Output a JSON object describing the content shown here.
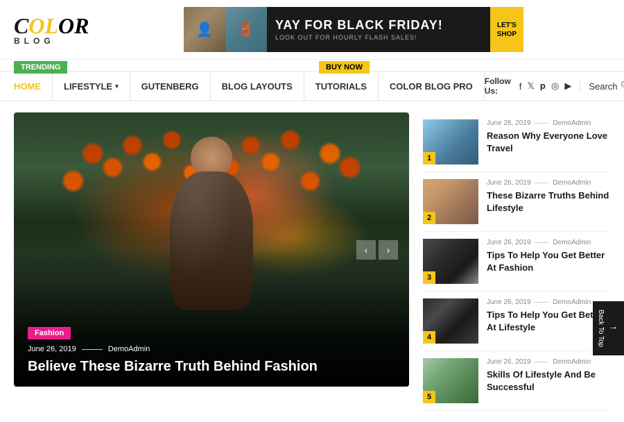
{
  "header": {
    "logo_color": "COLOR",
    "logo_blog": "BLOG",
    "ad": {
      "title": "YAY FOR BLACK FRIDAY!",
      "subtitle": "LOOK OUT FOR HOURLY FLASH SALES!",
      "button": "LET'S\nSHOP"
    }
  },
  "trending_bar": {
    "trending_label": "TRENDING",
    "buy_now_label": "BUY NOW"
  },
  "nav": {
    "items": [
      {
        "label": "HOME",
        "active": true,
        "has_dropdown": false
      },
      {
        "label": "LIFESTYLE",
        "active": false,
        "has_dropdown": true
      },
      {
        "label": "GUTENBERG",
        "active": false,
        "has_dropdown": false
      },
      {
        "label": "BLOG LAYOUTS",
        "active": false,
        "has_dropdown": false
      },
      {
        "label": "TUTORIALS",
        "active": false,
        "has_dropdown": false
      },
      {
        "label": "COLOR BLOG PRO",
        "active": false,
        "has_dropdown": false
      }
    ],
    "follow_us": "Follow Us:",
    "search_label": "Search"
  },
  "featured_post": {
    "category": "Fashion",
    "date": "June 26, 2019",
    "author": "DemoAdmin",
    "title": "Believe These Bizarre Truth Behind Fashion"
  },
  "sidebar_posts": [
    {
      "num": "1",
      "date": "June 26, 2019",
      "author": "DemoAdmin",
      "title": "Reason Why Everyone Love Travel",
      "thumb_class": "thumb-1"
    },
    {
      "num": "2",
      "date": "June 26, 2019",
      "author": "DemoAdmin",
      "title": "These Bizarre Truths Behind Lifestyle",
      "thumb_class": "thumb-2"
    },
    {
      "num": "3",
      "date": "June 26, 2019",
      "author": "DemoAdmin",
      "title": "Tips To Help You Get Better At Fashion",
      "thumb_class": "thumb-3"
    },
    {
      "num": "4",
      "date": "June 26, 2019",
      "author": "DemoAdmin",
      "title": "Tips To Help You Get Better At Lifestyle",
      "thumb_class": "thumb-4"
    },
    {
      "num": "5",
      "date": "June 26, 2019",
      "author": "DemoAdmin",
      "title": "Skills Of Lifestyle And Be Successful",
      "thumb_class": "thumb-5"
    }
  ],
  "back_to_top": "Back To Top",
  "social_icons": [
    "f",
    "t",
    "p",
    "◉",
    "▶"
  ]
}
